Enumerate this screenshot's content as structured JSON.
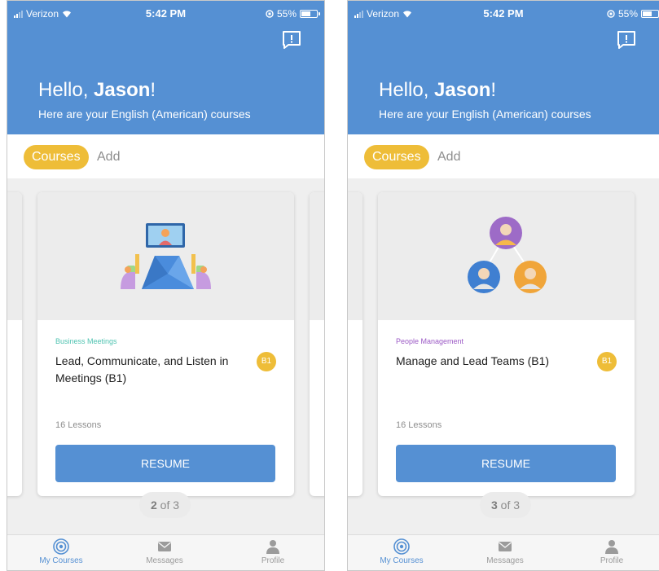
{
  "status_bar": {
    "carrier": "Verizon",
    "time": "5:42 PM",
    "battery": "55%"
  },
  "header": {
    "greeting_prefix": "Hello, ",
    "user_name": "Jason",
    "greeting_suffix": "!",
    "subtitle": "Here are your English (American) courses"
  },
  "tabs": {
    "courses": "Courses",
    "add": "Add"
  },
  "screens": [
    {
      "card": {
        "category": "Business Meetings",
        "title": "Lead, Communicate, and Listen in Meetings (B1)",
        "level": "B1",
        "lessons": "16 Lessons",
        "button": "RESUME",
        "category_color": "#4fc3b1"
      },
      "pager": {
        "current": "2",
        "of_text": " of 3"
      }
    },
    {
      "card": {
        "category": "People Management",
        "title": "Manage and Lead Teams (B1)",
        "level": "B1",
        "lessons": "16 Lessons",
        "button": "RESUME",
        "category_color": "#9b59c5"
      },
      "pager": {
        "current": "3",
        "of_text": " of 3"
      }
    }
  ],
  "tab_bar": {
    "my_courses": "My Courses",
    "messages": "Messages",
    "profile": "Profile"
  },
  "colors": {
    "primary": "#5590d3",
    "accent": "#eebd38",
    "background": "#efefef"
  }
}
